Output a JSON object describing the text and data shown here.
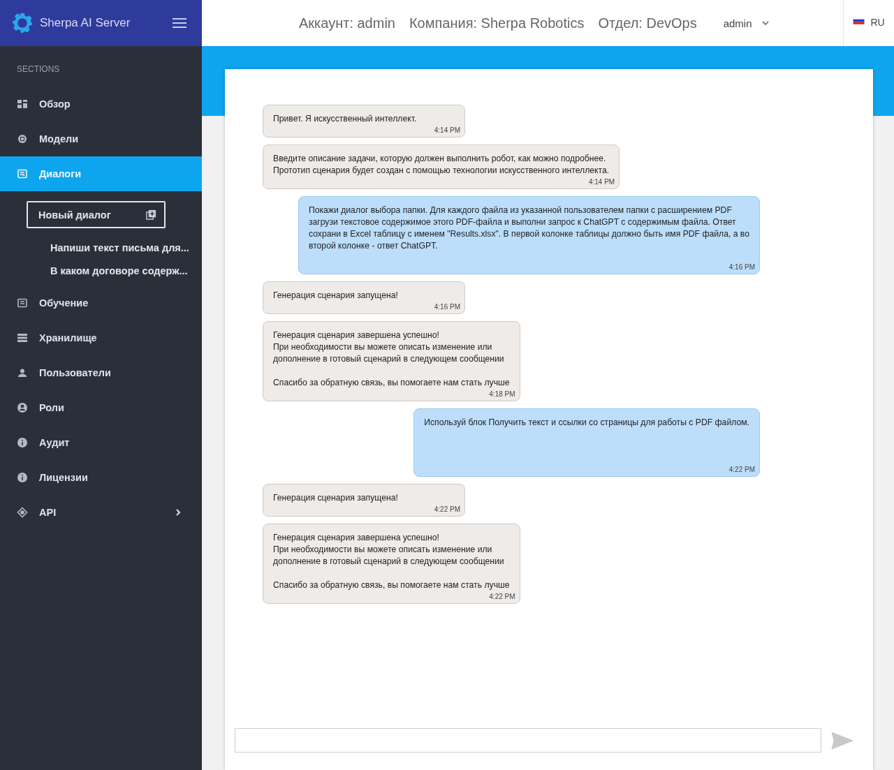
{
  "app": {
    "title": "Sherpa AI Server"
  },
  "header": {
    "account": "Аккаунт: admin",
    "company": "Компания: Sherpa Robotics",
    "department": "Отдел: DevOps",
    "user": "admin",
    "language": "RU"
  },
  "sidebar": {
    "section_label": "SECTIONS",
    "items": [
      {
        "label": "Обзор",
        "kind": "dashboard",
        "selected": false
      },
      {
        "label": "Модели",
        "kind": "chip",
        "selected": false
      },
      {
        "label": "Диалоги",
        "kind": "dialog",
        "selected": true,
        "action": "Новый диалог",
        "children": [
          {
            "label": "Напиши текст письма для..."
          },
          {
            "label": "В каком договоре содерж..."
          }
        ]
      },
      {
        "label": "Обучение",
        "kind": "training",
        "selected": false
      },
      {
        "label": "Хранилище",
        "kind": "storage",
        "selected": false
      },
      {
        "label": "Пользователи",
        "kind": "user",
        "selected": false
      },
      {
        "label": "Роли",
        "kind": "role",
        "selected": false
      },
      {
        "label": "Аудит",
        "kind": "info",
        "selected": false
      },
      {
        "label": "Лицензии",
        "kind": "info",
        "selected": false
      },
      {
        "label": "API",
        "kind": "api",
        "selected": false,
        "expandable": true
      }
    ]
  },
  "messages": [
    {
      "kind": "bot",
      "text": "Привет. Я искусственный интеллект.",
      "time": "4:14 PM"
    },
    {
      "kind": "bot",
      "text": "Введите описание задачи, которую должен выполнить робот, как можно подробнее.\nПрототип сценария будет создан с помощью технологии искусственного интеллекта.",
      "time": "4:14 PM"
    },
    {
      "kind": "user",
      "text": "Покажи диалог выбора папки. Для каждого файла из указанной пользователем папки с расширением PDF\nзагрузи текстовое содержимое этого PDF-файла и выполни запрос к ChatGPT с содержимым файла. Ответ\nсохрани в Excel таблицу с именем \"Results.xlsx\". В первой колонке таблицы должно быть имя PDF файла, а во\nвторой колонке - ответ ChatGPT.",
      "time": "4:16 PM"
    },
    {
      "kind": "bot",
      "text": "Генерация сценария запущена!",
      "time": "4:16 PM"
    },
    {
      "kind": "bot",
      "text": "Генерация сценария завершена успешно!\nПри необходимости вы можете описать изменение или\nдополнение в готовый сценарий в следующем сообщении\n\nСпасибо за обратную связь, вы помогаете нам стать лучше",
      "time": "4:18 PM"
    },
    {
      "kind": "user",
      "text": "Используй блок Получить текст и ссылки со страницы для работы с PDF файлом.",
      "time": "4:22 PM"
    },
    {
      "kind": "bot",
      "text": "Генерация сценария запущена!",
      "time": "4:22 PM"
    },
    {
      "kind": "bot",
      "text": "Генерация сценария завершена успешно!\nПри необходимости вы можете описать изменение или\nдополнение в готовый сценарий в следующем сообщении\n\nСпасибо за обратную связь, вы помогаете нам стать лучше",
      "time": "4:22 PM"
    }
  ]
}
